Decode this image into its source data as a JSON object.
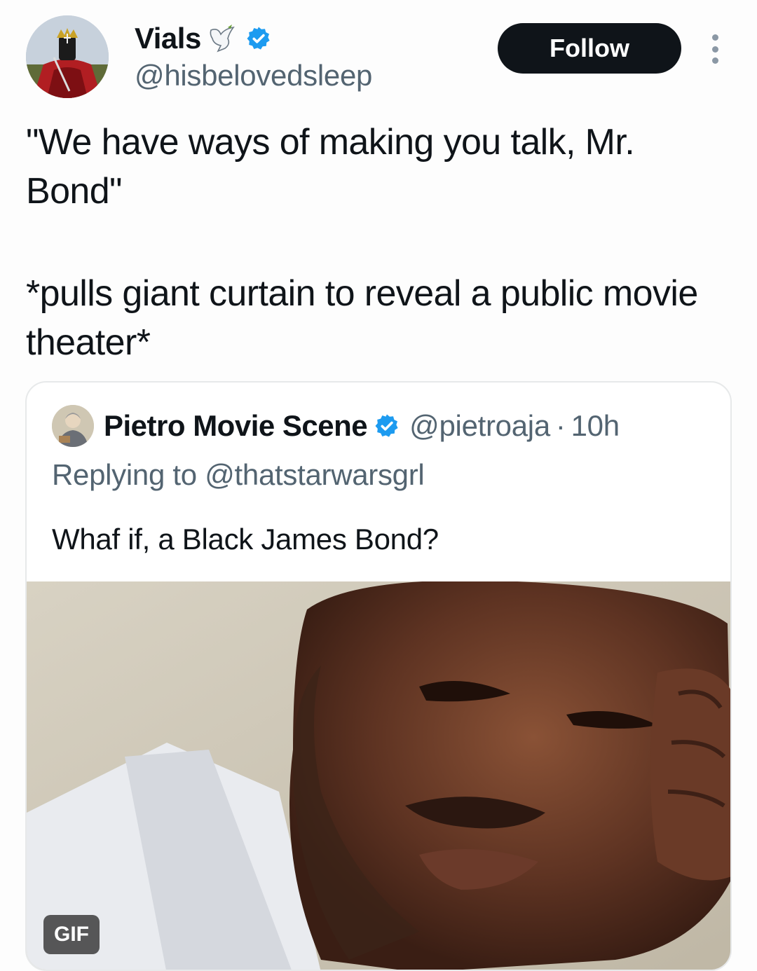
{
  "author": {
    "display_name": "Vials",
    "handle": "@hisbelovedsleep",
    "dove_icon": "dove-icon",
    "verified_icon": "verified-badge-icon",
    "verified_color": "#1d9bf0"
  },
  "actions": {
    "follow_label": "Follow",
    "more_icon": "more-vertical-icon"
  },
  "tweet": {
    "line1": "\"We have ways of making you talk, Mr. Bond\"",
    "line2": "*pulls giant curtain to reveal a public movie theater*"
  },
  "quoted_tweet": {
    "display_name": "Pietro Movie Scene",
    "handle": "@pietroaja",
    "separator": "·",
    "time": "10h",
    "replying_to": "Replying to @thatstarwarsgrl",
    "text": "Whaf if, a Black James Bond?",
    "media_badge": "GIF"
  },
  "colors": {
    "text_primary": "#0f1419",
    "text_secondary": "#536471",
    "follow_bg": "#0f1419",
    "border": "#e7e9ea"
  }
}
